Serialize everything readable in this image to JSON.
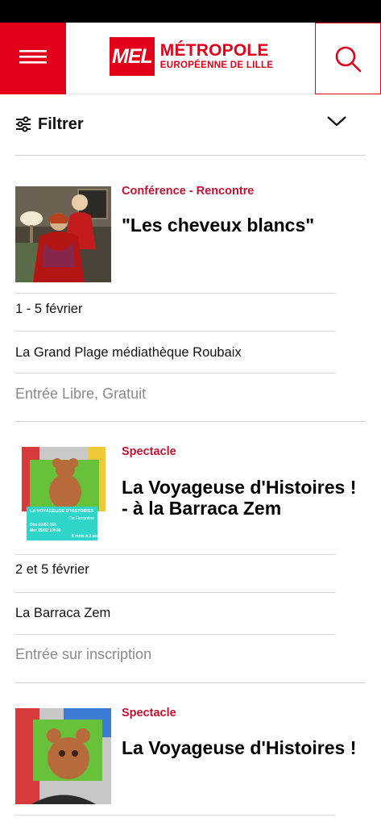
{
  "header": {
    "logo_mark": "MEL",
    "logo_line1": "MÉTROPOLE",
    "logo_line2": "EUROPÉENNE DE LILLE"
  },
  "filter": {
    "label": "Filtrer"
  },
  "events": [
    {
      "category": "Conférence - Rencontre",
      "title": "\"Les cheveux blancs\"",
      "dates": "1 - 5 février",
      "location": "La Grand Plage médiathèque Roubaix",
      "price": "Entrée Libre, Gratuit"
    },
    {
      "category": "Spectacle",
      "title": "La Voyageuse d'Histoires ! - à la Barraca Zem",
      "dates": "2 et 5 février",
      "location": "La Barraca Zem",
      "price": "Entrée sur inscription",
      "poster": {
        "title": "LA VOYAGEUSE D'HISTOIRES",
        "company": "Cie Flocontine",
        "line1": "Dim 02/02 16h",
        "line2": "Mer 05/02 10h30",
        "age": "6 mois à 3 ans"
      }
    },
    {
      "category": "Spectacle",
      "title": "La Voyageuse d'Histoires !"
    }
  ],
  "colors": {
    "brand_red": "#e2001a",
    "category_red": "#c8102e"
  }
}
